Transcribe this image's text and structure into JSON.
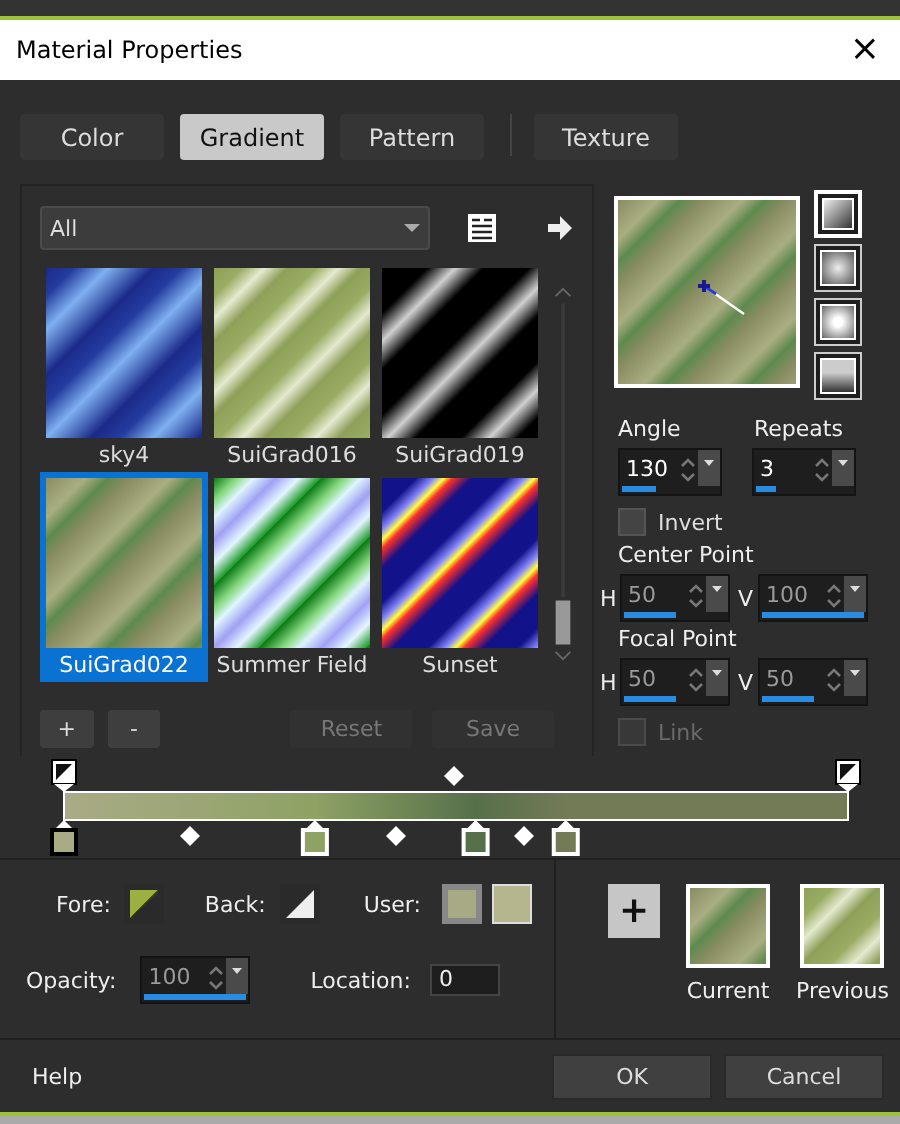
{
  "window": {
    "title": "Material Properties",
    "close": "×"
  },
  "tabs": [
    {
      "label": "Color",
      "selected": false
    },
    {
      "label": "Gradient",
      "selected": true
    },
    {
      "label": "Pattern",
      "selected": false
    },
    {
      "label": "Texture",
      "selected": false
    }
  ],
  "library": {
    "category": "All",
    "gradients": [
      {
        "name": "sky4",
        "selected": false
      },
      {
        "name": "SuiGrad016",
        "selected": false
      },
      {
        "name": "SuiGrad019",
        "selected": false
      },
      {
        "name": "SuiGrad022",
        "selected": true
      },
      {
        "name": "Summer Field",
        "selected": false
      },
      {
        "name": "Sunset",
        "selected": false
      }
    ],
    "buttons": [
      {
        "label": "+",
        "disabled": false
      },
      {
        "label": "-",
        "disabled": false
      },
      {
        "label": "Reset",
        "disabled": true
      },
      {
        "label": "Save",
        "disabled": true
      }
    ]
  },
  "styles": [
    {
      "selected": true
    },
    {
      "selected": false
    },
    {
      "selected": false
    },
    {
      "selected": false
    }
  ],
  "angle": {
    "label": "Angle",
    "value": "130",
    "level": 0.36,
    "disabled": false
  },
  "repeats": {
    "label": "Repeats",
    "value": "3",
    "level": 0.2,
    "disabled": false
  },
  "invert": {
    "label": "Invert",
    "checked": false,
    "disabled": false
  },
  "center_point": {
    "label": "Center Point",
    "h": {
      "label": "H",
      "value": "50",
      "level": 0.5,
      "disabled": true
    },
    "v": {
      "label": "V",
      "value": "100",
      "level": 1,
      "disabled": true
    }
  },
  "focal_point": {
    "label": "Focal Point",
    "h": {
      "label": "H",
      "value": "50",
      "level": 0.5,
      "disabled": true
    },
    "v": {
      "label": "V",
      "value": "50",
      "level": 0.5,
      "disabled": true
    }
  },
  "link": {
    "label": "Link",
    "checked": false,
    "disabled": true
  },
  "editor": {
    "color_stops": [
      {
        "color": "#a9ab86",
        "selected": true
      },
      {
        "color": "#8ea264",
        "selected": false
      },
      {
        "color": "#56704a",
        "selected": false
      },
      {
        "color": "#737a56",
        "selected": false
      }
    ]
  },
  "stop_properties": {
    "fore": {
      "label": "Fore:"
    },
    "back": {
      "label": "Back:"
    },
    "user": {
      "label": "User:",
      "colors": [
        {
          "color": "#a8aa86",
          "selected": true
        },
        {
          "color": "#b5b58e",
          "selected": false
        }
      ]
    },
    "opacity": {
      "label": "Opacity:",
      "value": "100",
      "level": 1,
      "disabled": true
    },
    "location": {
      "label": "Location:",
      "value": "0"
    }
  },
  "swatches": {
    "add": "+",
    "items": [
      {
        "label": "Current"
      },
      {
        "label": "Previous"
      }
    ]
  },
  "footer": {
    "help": "Help",
    "buttons": [
      {
        "label": "OK"
      },
      {
        "label": "Cancel"
      }
    ]
  }
}
